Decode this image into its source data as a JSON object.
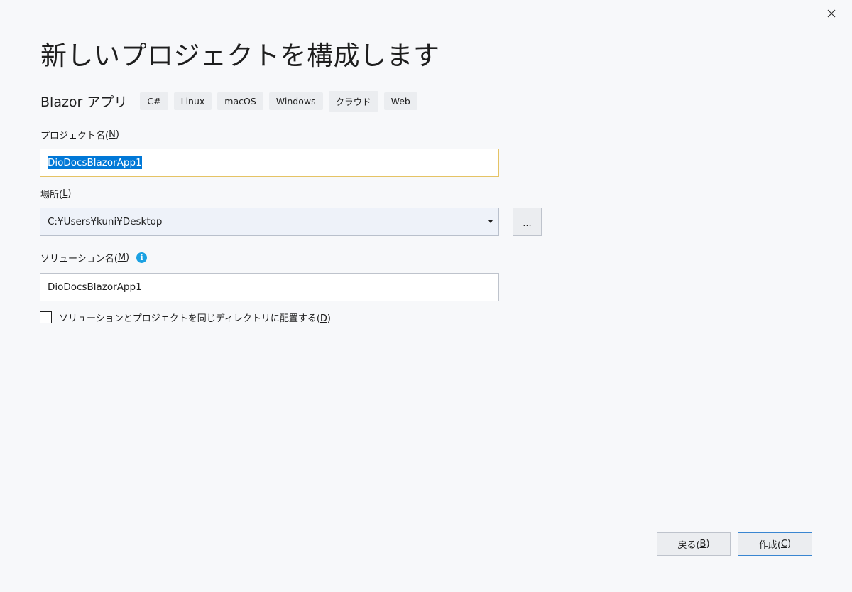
{
  "dialog": {
    "title": "新しいプロジェクトを構成します"
  },
  "template": {
    "name": "Blazor アプリ",
    "tags": [
      "C#",
      "Linux",
      "macOS",
      "Windows",
      "クラウド",
      "Web"
    ]
  },
  "project_name": {
    "label": "プロジェクト名(",
    "accel": "N",
    "label_end": ")",
    "value": "DioDocsBlazorApp1"
  },
  "location": {
    "label": "場所(",
    "accel": "L",
    "label_end": ")",
    "value": "C:¥Users¥kuni¥Desktop",
    "browse_label": "..."
  },
  "solution_name": {
    "label": "ソリューション名(",
    "accel": "M",
    "label_end": ")",
    "value": "DioDocsBlazorApp1"
  },
  "same_directory": {
    "label": "ソリューションとプロジェクトを同じディレクトリに配置する(",
    "accel": "D",
    "label_end": ")",
    "checked": false
  },
  "footer": {
    "back_label": "戻る(",
    "back_accel": "B",
    "back_end": ")",
    "create_label": "作成(",
    "create_accel": "C",
    "create_end": ")"
  },
  "colors": {
    "accent": "#0078d7",
    "info": "#1ba1e2",
    "focus_border": "#e5c365"
  },
  "icons": {
    "close": "close-icon",
    "dropdown": "chevron-down-icon",
    "info": "info-icon"
  }
}
